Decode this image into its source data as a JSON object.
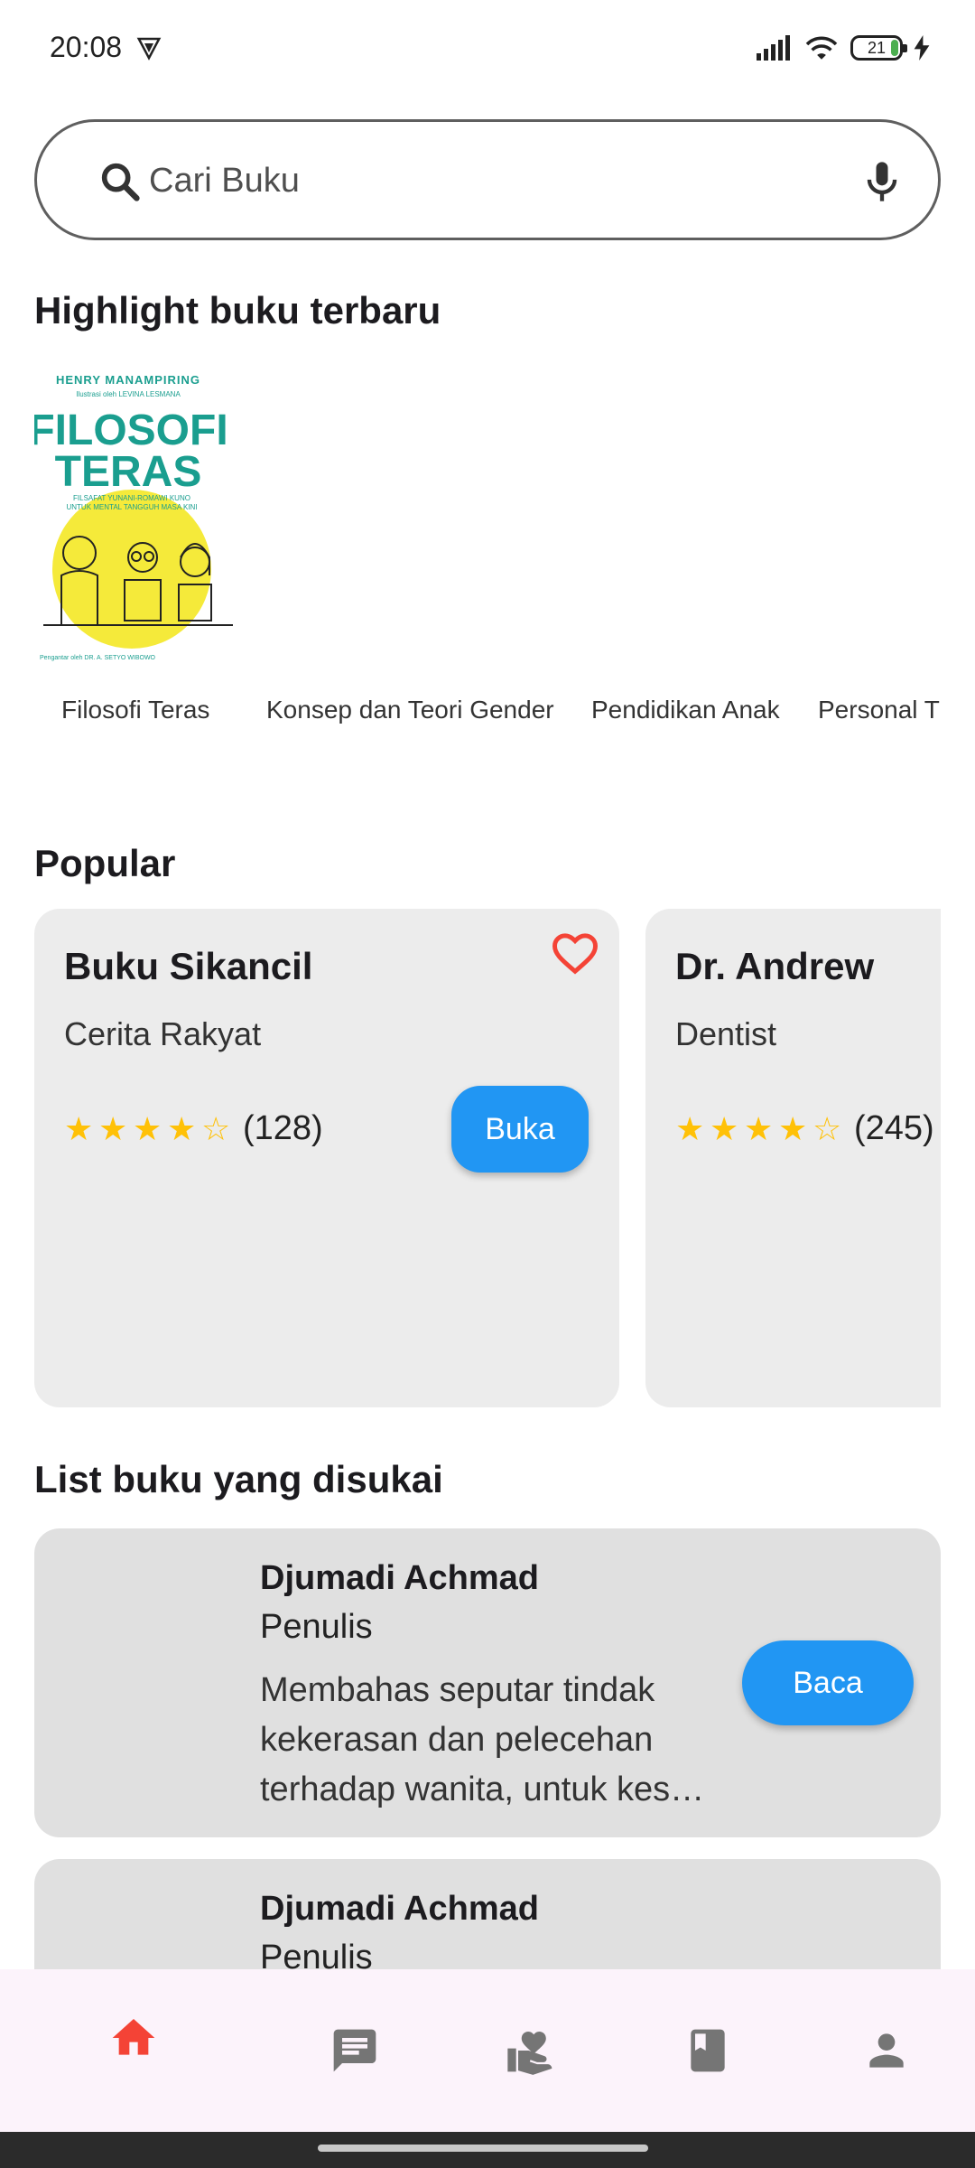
{
  "status_bar": {
    "time": "20:08",
    "battery_level": "21",
    "icons": [
      "vpn-icon",
      "signal-icon",
      "wifi-icon",
      "battery-icon",
      "charging-icon"
    ]
  },
  "search": {
    "placeholder": "Cari Buku",
    "icons": [
      "search-icon",
      "mic-icon"
    ]
  },
  "highlight": {
    "title": "Highlight buku terbaru",
    "cover": {
      "author": "HENRY MANAMPIRING",
      "illustrator": "Ilustrasi oleh LEVINA LESMANA",
      "title_line1": "FILOSOFI",
      "title_line2": "TERAS",
      "subtitle_line1": "FILSAFAT YUNANI-ROMAWI KUNO",
      "subtitle_line2": "UNTUK MENTAL TANGGUH MASA KINI",
      "foreword": "Pengantar oleh DR. A. SETYO WIBOWO"
    },
    "books": [
      "Filosofi Teras",
      "Konsep dan Teori Gender",
      "Pendidikan Anak",
      "Personal T"
    ]
  },
  "popular": {
    "title": "Popular",
    "cards": [
      {
        "title": "Buku Sikancil",
        "subtitle": "Cerita Rakyat",
        "rating": 4,
        "count": "(128)",
        "button": "Buka",
        "favorite": true
      },
      {
        "title": "Dr. Andrew",
        "subtitle": "Dentist",
        "rating": 4,
        "count": "(245)"
      }
    ]
  },
  "liked": {
    "title": "List buku yang disukai",
    "items": [
      {
        "name": "Djumadi Achmad",
        "role": "Penulis",
        "description": "Membahas seputar tindak kekerasan dan pelecehan terhadap wanita, untuk kes…",
        "button": "Baca"
      },
      {
        "name": "Djumadi Achmad",
        "role": "Penulis"
      }
    ]
  },
  "bottom_nav": {
    "active": "home",
    "items": [
      "home-icon",
      "chat-icon",
      "donate-icon",
      "book-icon",
      "profile-icon"
    ],
    "active_color": "#f44336",
    "inactive_color": "#757575"
  },
  "colors": {
    "accent": "#2196f3",
    "star": "#ffc107",
    "heart": "#f44336"
  }
}
